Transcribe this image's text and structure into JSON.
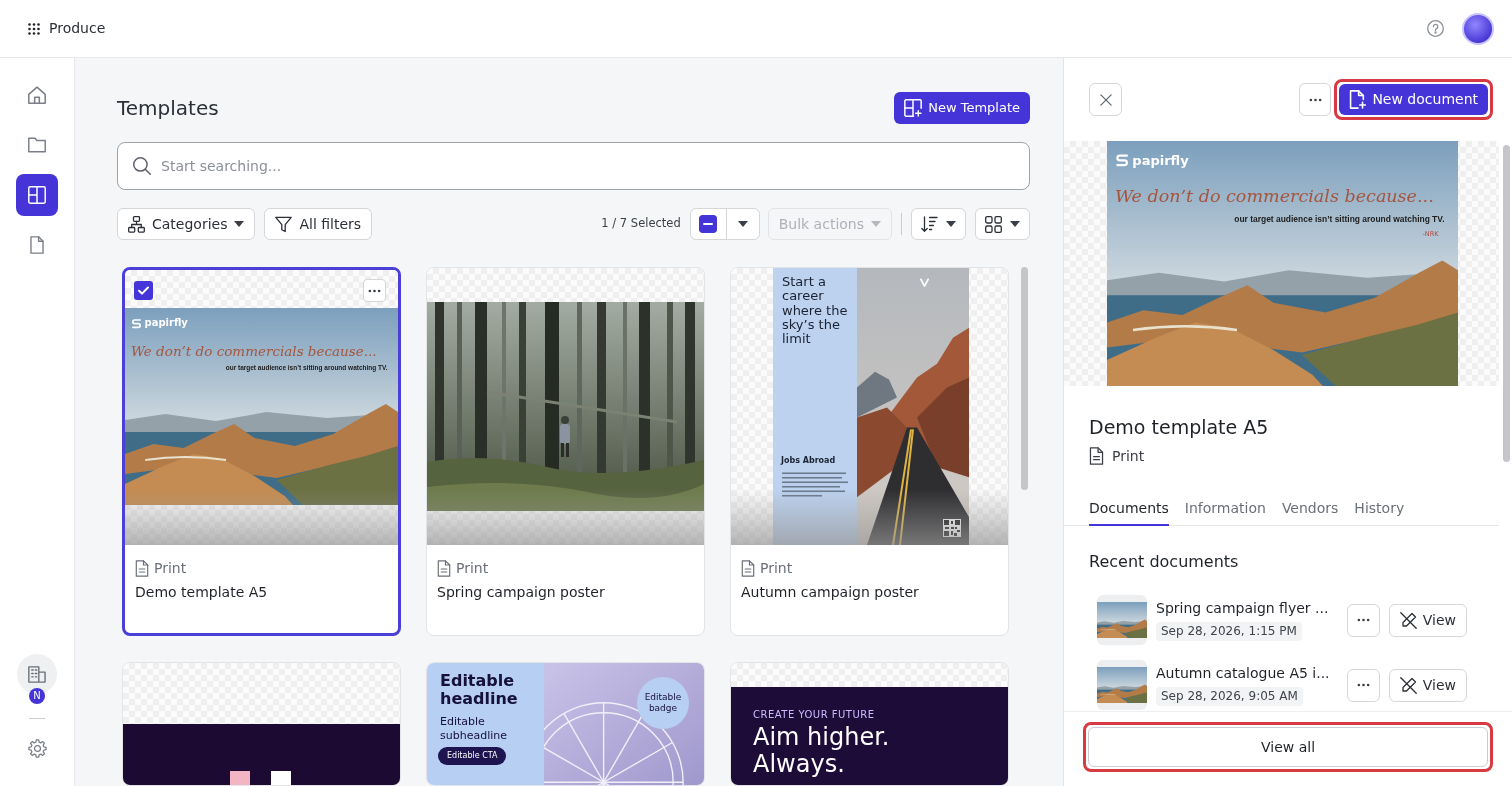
{
  "topbar": {
    "app_name": "Produce"
  },
  "sidebar": {
    "items": [
      {
        "kind": "home",
        "selected": false
      },
      {
        "kind": "folder",
        "selected": false
      },
      {
        "kind": "templates",
        "selected": true
      },
      {
        "kind": "document",
        "selected": false
      }
    ],
    "workspace": {
      "badge": "N"
    }
  },
  "main": {
    "title": "Templates",
    "new_button": "New Template",
    "search": {
      "placeholder": "Start searching..."
    },
    "toolbar": {
      "filters": [
        {
          "label": "Categories",
          "kind": "categories"
        },
        {
          "label": "All filters",
          "kind": "filters"
        }
      ],
      "selection_count": "1 / 7 Selected",
      "select_all": {
        "indeterminate": true
      },
      "bulk_actions": {
        "label": "Bulk actions",
        "disabled": true
      }
    },
    "cards": [
      {
        "type": "Print",
        "title": "Demo template A5",
        "selected": true,
        "preview": {
          "kind": "ad",
          "logo": "papirfly",
          "headline": "We don’t do commercials because...",
          "subline": "our target audience isn’t sitting around watching TV."
        }
      },
      {
        "type": "Print",
        "title": "Spring campaign poster",
        "selected": false,
        "preview": {
          "kind": "forest"
        }
      },
      {
        "type": "Print",
        "title": "Autumn campaign poster",
        "selected": false,
        "preview": {
          "kind": "career",
          "headline": "Start a career where the sky’s the limit",
          "section": "Jobs Abroad"
        }
      },
      {
        "selected": false,
        "preview": {
          "kind": "shapes"
        }
      },
      {
        "selected": false,
        "preview": {
          "kind": "editable",
          "headline": "Editable headline",
          "subheadline": "Editable subheadline",
          "cta": "Editable CTA",
          "badge": "Editable badge"
        }
      },
      {
        "selected": false,
        "preview": {
          "kind": "future",
          "eyebrow": "CREATE YOUR FUTURE",
          "headline": "Aim higher. Always."
        }
      }
    ]
  },
  "panel": {
    "new_button": {
      "label": "New document",
      "highlighted": true
    },
    "preview": {
      "kind": "ad",
      "logo": "papirfly",
      "headline": "We don’t do commercials because...",
      "subline": "our target audience isn’t sitting around watching TV.",
      "signature": "-NRK"
    },
    "title": "Demo template A5",
    "type": "Print",
    "tabs": [
      {
        "label": "Documents",
        "selected": true
      },
      {
        "label": "Information",
        "selected": false
      },
      {
        "label": "Vendors",
        "selected": false
      },
      {
        "label": "History",
        "selected": false
      }
    ],
    "section_title": "Recent documents",
    "documents": [
      {
        "name": "Spring campaign flyer ...",
        "date": "Sep 28, 2026, 1:15 PM",
        "action": "View"
      },
      {
        "name": "Autumn catalogue A5 i...",
        "date": "Sep 28, 2026, 9:05 AM",
        "action": "View"
      }
    ],
    "view_all": {
      "label": "View all",
      "highlighted": true
    }
  }
}
